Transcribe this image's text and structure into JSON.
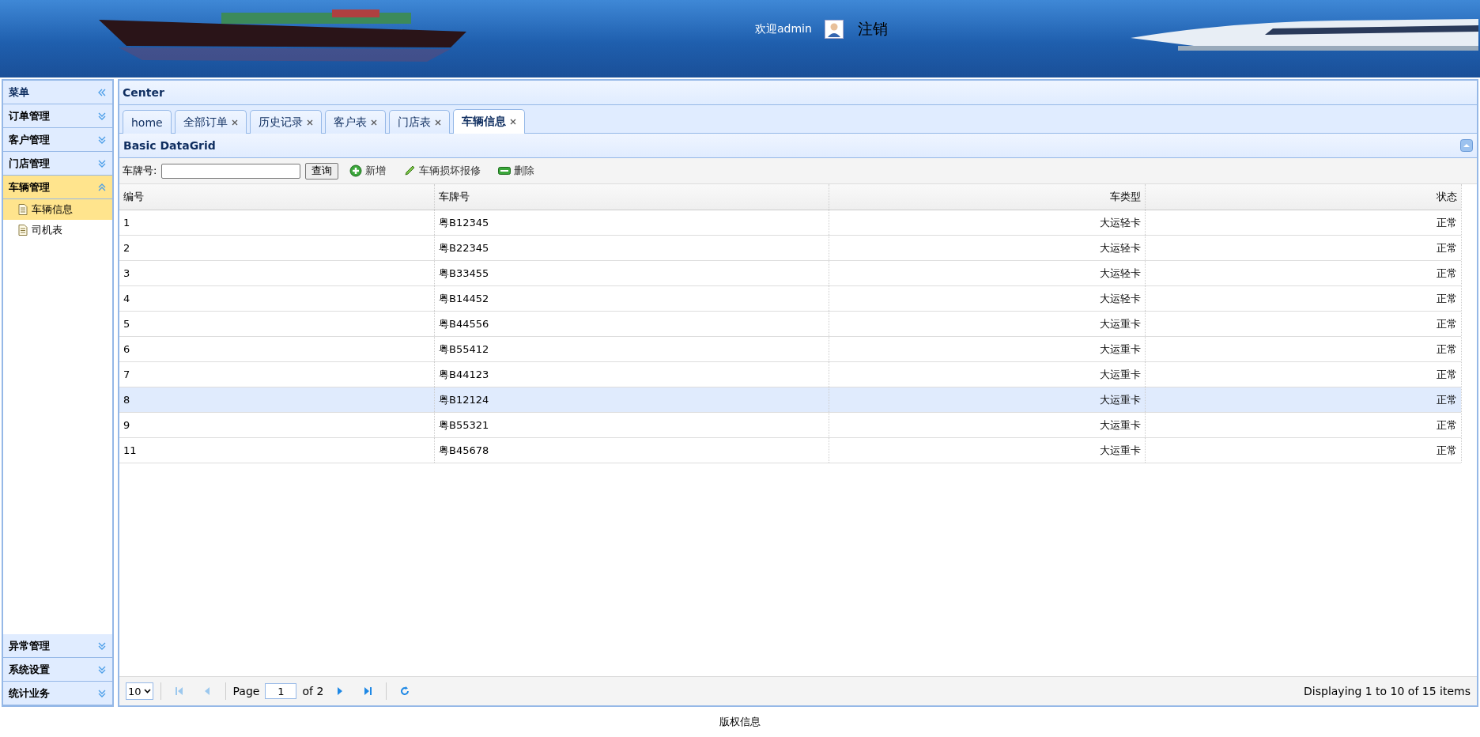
{
  "header": {
    "welcome": "欢迎admin",
    "logout": "注销"
  },
  "menu": {
    "title": "菜单",
    "sections": [
      {
        "label": "订单管理",
        "expanded": false
      },
      {
        "label": "客户管理",
        "expanded": false
      },
      {
        "label": "门店管理",
        "expanded": false
      },
      {
        "label": "车辆管理",
        "expanded": true,
        "children": [
          {
            "label": "车辆信息",
            "selected": true
          },
          {
            "label": "司机表",
            "selected": false
          }
        ]
      },
      {
        "label": "异常管理",
        "expanded": false
      },
      {
        "label": "系统设置",
        "expanded": false
      },
      {
        "label": "统计业务",
        "expanded": false
      }
    ]
  },
  "center": {
    "title": "Center",
    "tabs": [
      {
        "label": "home",
        "closable": false,
        "selected": false
      },
      {
        "label": "全部订单",
        "closable": true,
        "selected": false
      },
      {
        "label": "历史记录",
        "closable": true,
        "selected": false
      },
      {
        "label": "客户表",
        "closable": true,
        "selected": false
      },
      {
        "label": "门店表",
        "closable": true,
        "selected": false
      },
      {
        "label": "车辆信息",
        "closable": true,
        "selected": true
      }
    ]
  },
  "grid": {
    "title": "Basic DataGrid",
    "search_label": "车牌号:",
    "search_button": "查询",
    "actions": [
      {
        "kind": "add",
        "label": "新增"
      },
      {
        "kind": "edit",
        "label": "车辆损坏报修"
      },
      {
        "kind": "remove",
        "label": "删除"
      }
    ],
    "columns": [
      {
        "label": "编号",
        "right_aligned": false
      },
      {
        "label": "车牌号",
        "right_aligned": false
      },
      {
        "label": "车类型",
        "right_aligned": true
      },
      {
        "label": "状态",
        "right_aligned": true
      }
    ],
    "rows": [
      {
        "cells": [
          "1",
          "粤B12345",
          "大运轻卡",
          "正常"
        ],
        "selected": false
      },
      {
        "cells": [
          "2",
          "粤B22345",
          "大运轻卡",
          "正常"
        ],
        "selected": false
      },
      {
        "cells": [
          "3",
          "粤B33455",
          "大运轻卡",
          "正常"
        ],
        "selected": false
      },
      {
        "cells": [
          "4",
          "粤B14452",
          "大运轻卡",
          "正常"
        ],
        "selected": false
      },
      {
        "cells": [
          "5",
          "粤B44556",
          "大运重卡",
          "正常"
        ],
        "selected": false
      },
      {
        "cells": [
          "6",
          "粤B55412",
          "大运重卡",
          "正常"
        ],
        "selected": false
      },
      {
        "cells": [
          "7",
          "粤B44123",
          "大运重卡",
          "正常"
        ],
        "selected": false
      },
      {
        "cells": [
          "8",
          "粤B12124",
          "大运重卡",
          "正常"
        ],
        "selected": true
      },
      {
        "cells": [
          "9",
          "粤B55321",
          "大运重卡",
          "正常"
        ],
        "selected": false
      },
      {
        "cells": [
          "11",
          "粤B45678",
          "大运重卡",
          "正常"
        ],
        "selected": false
      }
    ],
    "pager": {
      "page_size": "10",
      "page_label": "Page",
      "page": "1",
      "of_label": "of 2",
      "buttons": [
        {
          "kind": "first",
          "disabled": true
        },
        {
          "kind": "prev",
          "disabled": true
        },
        {
          "kind": "sep"
        },
        {
          "kind": "next",
          "disabled": false
        },
        {
          "kind": "last",
          "disabled": false
        },
        {
          "kind": "sep"
        },
        {
          "kind": "refresh",
          "disabled": false
        }
      ],
      "summary": "Displaying 1 to 10 of 15 items"
    }
  },
  "footer": {
    "text": "版权信息"
  }
}
